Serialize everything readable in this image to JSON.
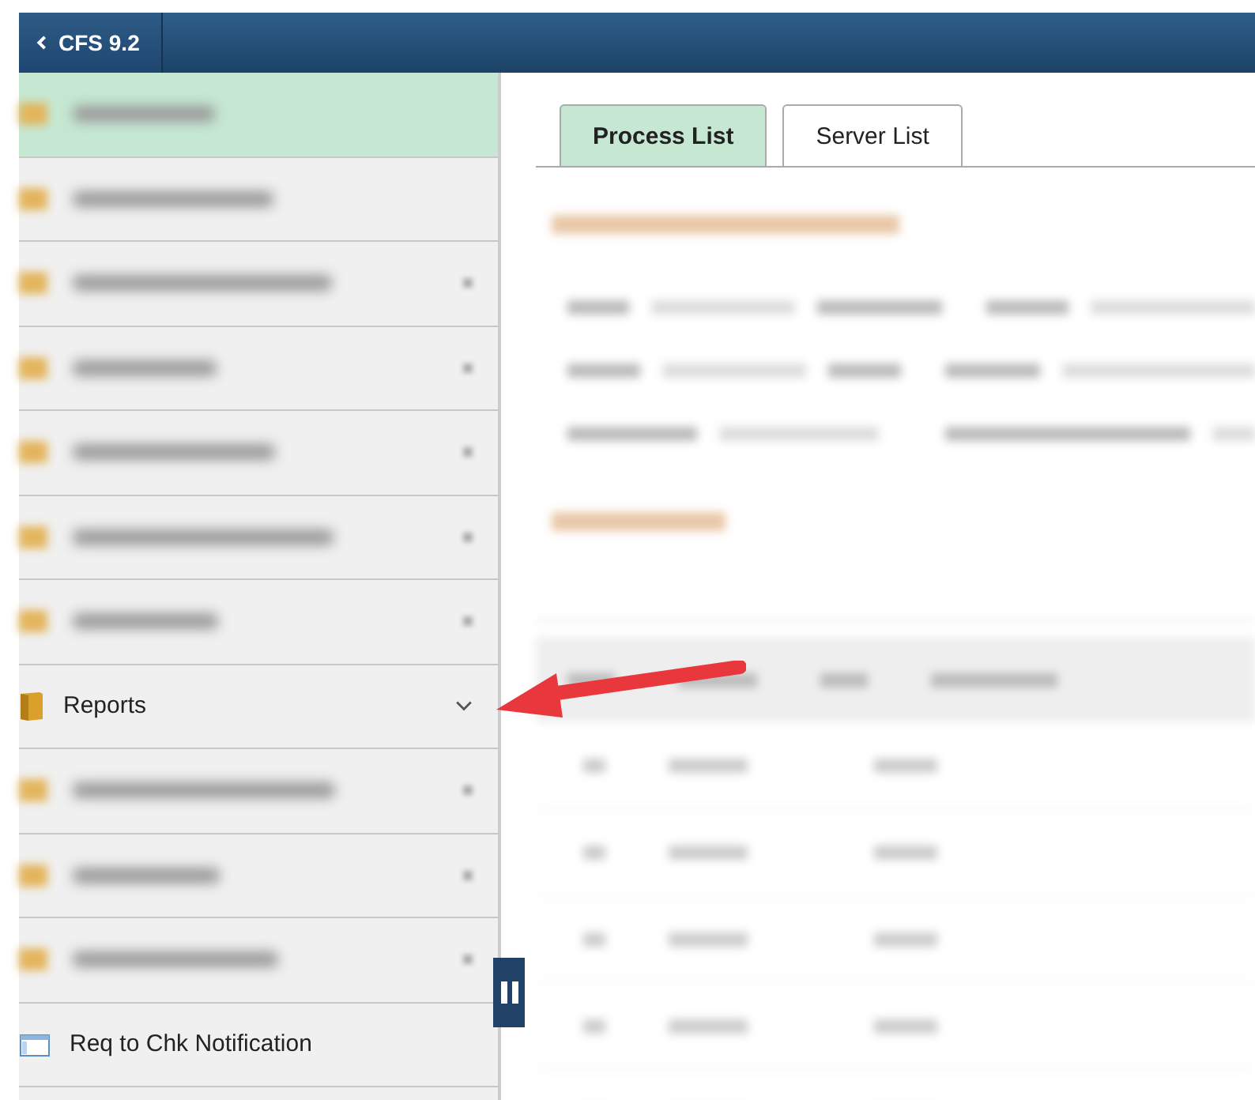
{
  "header": {
    "back_label": "CFS 9.2"
  },
  "sidebar": {
    "items": [
      {
        "kind": "blurred",
        "selected": true,
        "chevron": false
      },
      {
        "kind": "blurred",
        "selected": false,
        "chevron": false
      },
      {
        "kind": "blurred",
        "selected": false,
        "chevron": true
      },
      {
        "kind": "blurred",
        "selected": false,
        "chevron": true
      },
      {
        "kind": "blurred",
        "selected": false,
        "chevron": true
      },
      {
        "kind": "blurred",
        "selected": false,
        "chevron": true
      },
      {
        "kind": "blurred",
        "selected": false,
        "chevron": true
      },
      {
        "kind": "folder",
        "label": "Reports",
        "selected": false,
        "chevron": true
      },
      {
        "kind": "blurred",
        "selected": false,
        "chevron": true
      },
      {
        "kind": "blurred",
        "selected": false,
        "chevron": true
      },
      {
        "kind": "blurred",
        "selected": false,
        "chevron": true
      },
      {
        "kind": "page",
        "label": "Req to Chk Notification",
        "selected": false,
        "chevron": false
      }
    ]
  },
  "tabs": [
    {
      "label": "Process List",
      "selected": true
    },
    {
      "label": "Server List",
      "selected": false
    }
  ],
  "content": {
    "blurred": true
  },
  "annotation": {
    "kind": "arrow"
  }
}
